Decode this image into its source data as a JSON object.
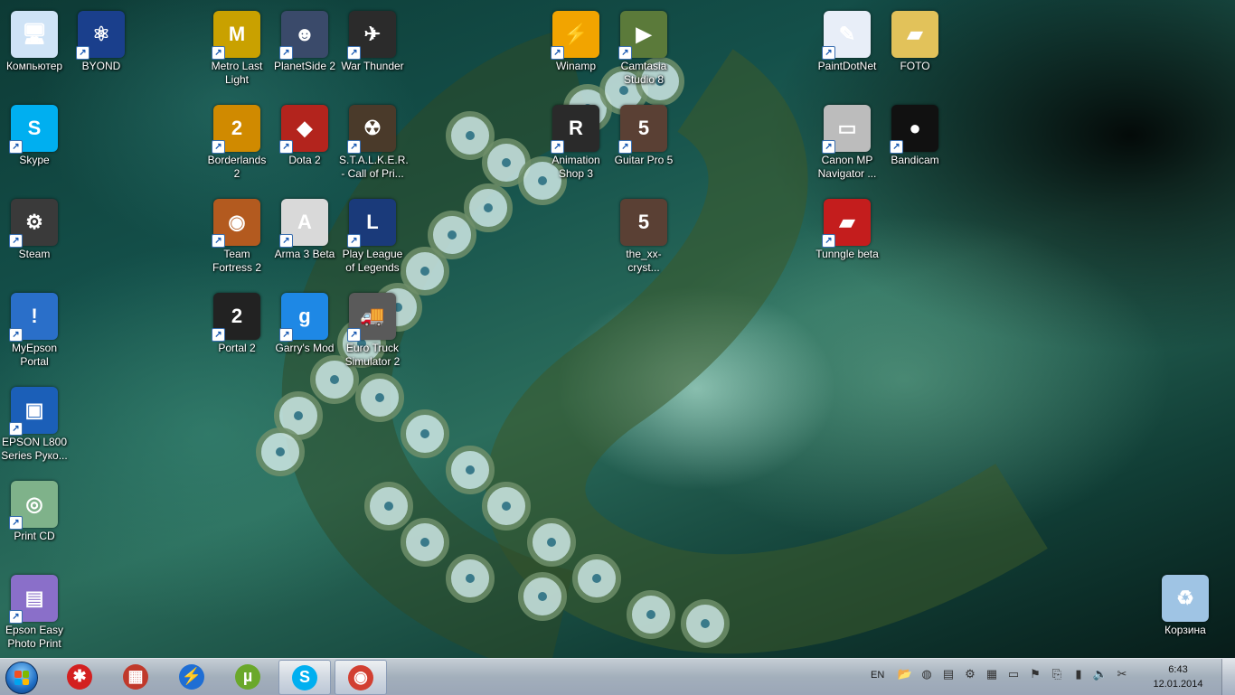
{
  "desktop": {
    "icons": [
      {
        "label": "Компьютер",
        "icon": "computer-icon",
        "bg": "#cfe3f6",
        "glyph": "🖥",
        "shortcut": false
      },
      {
        "label": "BYOND",
        "icon": "byond-icon",
        "bg": "#1a3f8c",
        "glyph": "⚛",
        "shortcut": true
      },
      {
        "label": "Skype",
        "icon": "skype-icon",
        "bg": "#00aff0",
        "glyph": "S",
        "shortcut": true
      },
      {
        "label": "Steam",
        "icon": "steam-icon",
        "bg": "#3a3a3a",
        "glyph": "⚙",
        "shortcut": true
      },
      {
        "label": "MyEpson Portal",
        "icon": "myepson-icon",
        "bg": "#2a6fc9",
        "glyph": "!",
        "shortcut": true
      },
      {
        "label": "EPSON L800 Series Руко...",
        "icon": "epson-manual-icon",
        "bg": "#1b5fb8",
        "glyph": "▣",
        "shortcut": true
      },
      {
        "label": "Print CD",
        "icon": "print-cd-icon",
        "bg": "#7fb28a",
        "glyph": "◎",
        "shortcut": true
      },
      {
        "label": "Epson Easy Photo Print",
        "icon": "epson-photo-icon",
        "bg": "#8a6fc9",
        "glyph": "▤",
        "shortcut": true
      },
      {
        "label": "Metro Last Light",
        "icon": "metro-icon",
        "bg": "#c9a100",
        "glyph": "M",
        "shortcut": true
      },
      {
        "label": "PlanetSide 2",
        "icon": "planetside-icon",
        "bg": "#3a4a6a",
        "glyph": "☻",
        "shortcut": true
      },
      {
        "label": "War Thunder",
        "icon": "war-thunder-icon",
        "bg": "#2b2b2b",
        "glyph": "✈",
        "shortcut": true
      },
      {
        "label": "Borderlands 2",
        "icon": "borderlands-icon",
        "bg": "#d08a00",
        "glyph": "2",
        "shortcut": true
      },
      {
        "label": "Dota 2",
        "icon": "dota-icon",
        "bg": "#b3241d",
        "glyph": "◆",
        "shortcut": true
      },
      {
        "label": "S.T.A.L.K.E.R. - Call of Pri...",
        "icon": "stalker-icon",
        "bg": "#4a3a2a",
        "glyph": "☢",
        "shortcut": true
      },
      {
        "label": "Team Fortress 2",
        "icon": "tf2-icon",
        "bg": "#b35a1f",
        "glyph": "◉",
        "shortcut": true
      },
      {
        "label": "Arma 3 Beta",
        "icon": "arma-icon",
        "bg": "#d9d9d9",
        "glyph": "A",
        "shortcut": true
      },
      {
        "label": "Play League of Legends",
        "icon": "lol-icon",
        "bg": "#1a3a7a",
        "glyph": "L",
        "shortcut": true
      },
      {
        "label": "Portal 2",
        "icon": "portal-icon",
        "bg": "#222222",
        "glyph": "2",
        "shortcut": true
      },
      {
        "label": "Garry's Mod",
        "icon": "gmod-icon",
        "bg": "#1e88e5",
        "glyph": "g",
        "shortcut": true
      },
      {
        "label": "Euro Truck Simulator 2",
        "icon": "ets-icon",
        "bg": "#5a5a5a",
        "glyph": "🚚",
        "shortcut": true
      },
      {
        "label": "Winamp",
        "icon": "winamp-icon",
        "bg": "#f2a400",
        "glyph": "⚡",
        "shortcut": true
      },
      {
        "label": "Camtasia Studio 8",
        "icon": "camtasia-icon",
        "bg": "#5b7a3a",
        "glyph": "▶",
        "shortcut": true
      },
      {
        "label": "Animation Shop 3",
        "icon": "animation-shop-icon",
        "bg": "#2a2a2a",
        "glyph": "R",
        "shortcut": true
      },
      {
        "label": "Guitar Pro 5",
        "icon": "guitar-pro-icon",
        "bg": "#5a4034",
        "glyph": "5",
        "shortcut": true
      },
      {
        "label": "the_xx-cryst...",
        "icon": "guitar-pro-file-icon",
        "bg": "#5a4034",
        "glyph": "5",
        "shortcut": false
      },
      {
        "label": "PaintDotNet",
        "icon": "paintdotnet-icon",
        "bg": "#e8eef8",
        "glyph": "✎",
        "shortcut": true
      },
      {
        "label": "FOTO",
        "icon": "folder-icon",
        "bg": "#e2c25a",
        "glyph": "▰",
        "shortcut": false
      },
      {
        "label": "Canon MP Navigator ...",
        "icon": "canon-icon",
        "bg": "#bcbcbc",
        "glyph": "▭",
        "shortcut": true
      },
      {
        "label": "Bandicam",
        "icon": "bandicam-icon",
        "bg": "#111111",
        "glyph": "●",
        "shortcut": true
      },
      {
        "label": "Tunngle beta",
        "icon": "tunngle-icon",
        "bg": "#c41d1d",
        "glyph": "▰",
        "shortcut": true
      },
      {
        "label": "Корзина",
        "icon": "recycle-bin-icon",
        "bg": "#9fc4e4",
        "glyph": "♻",
        "shortcut": false
      }
    ]
  },
  "taskbar": {
    "pinned": [
      {
        "name": "taskbar-app-red",
        "bg": "#d32020",
        "glyph": "✱",
        "active": false
      },
      {
        "name": "taskbar-app-calendar",
        "bg": "#c0392b",
        "glyph": "▦",
        "active": false
      },
      {
        "name": "taskbar-app-lightning",
        "bg": "#1f6ed4",
        "glyph": "⚡",
        "active": false
      },
      {
        "name": "taskbar-app-utorrent",
        "bg": "#6aa82a",
        "glyph": "µ",
        "active": false
      },
      {
        "name": "taskbar-app-skype",
        "bg": "#00aff0",
        "glyph": "S",
        "active": true
      },
      {
        "name": "taskbar-app-chrome",
        "bg": "#d23f31",
        "glyph": "◉",
        "active": true
      }
    ],
    "language": "EN",
    "tray_icons": [
      "folder-tray-icon",
      "network-tray-icon",
      "note-tray-icon",
      "steam-tray-icon",
      "window-tray-icon",
      "monitor-tray-icon",
      "flag-tray-icon",
      "usb-tray-icon",
      "signal-tray-icon",
      "volume-tray-icon",
      "tool-tray-icon"
    ],
    "tray_glyphs": [
      "📂",
      "◍",
      "▤",
      "⚙",
      "▦",
      "▭",
      "⚑",
      "⎘",
      "▮",
      "🔈",
      "✂"
    ],
    "time": "6:43",
    "date": "12.01.2014"
  }
}
